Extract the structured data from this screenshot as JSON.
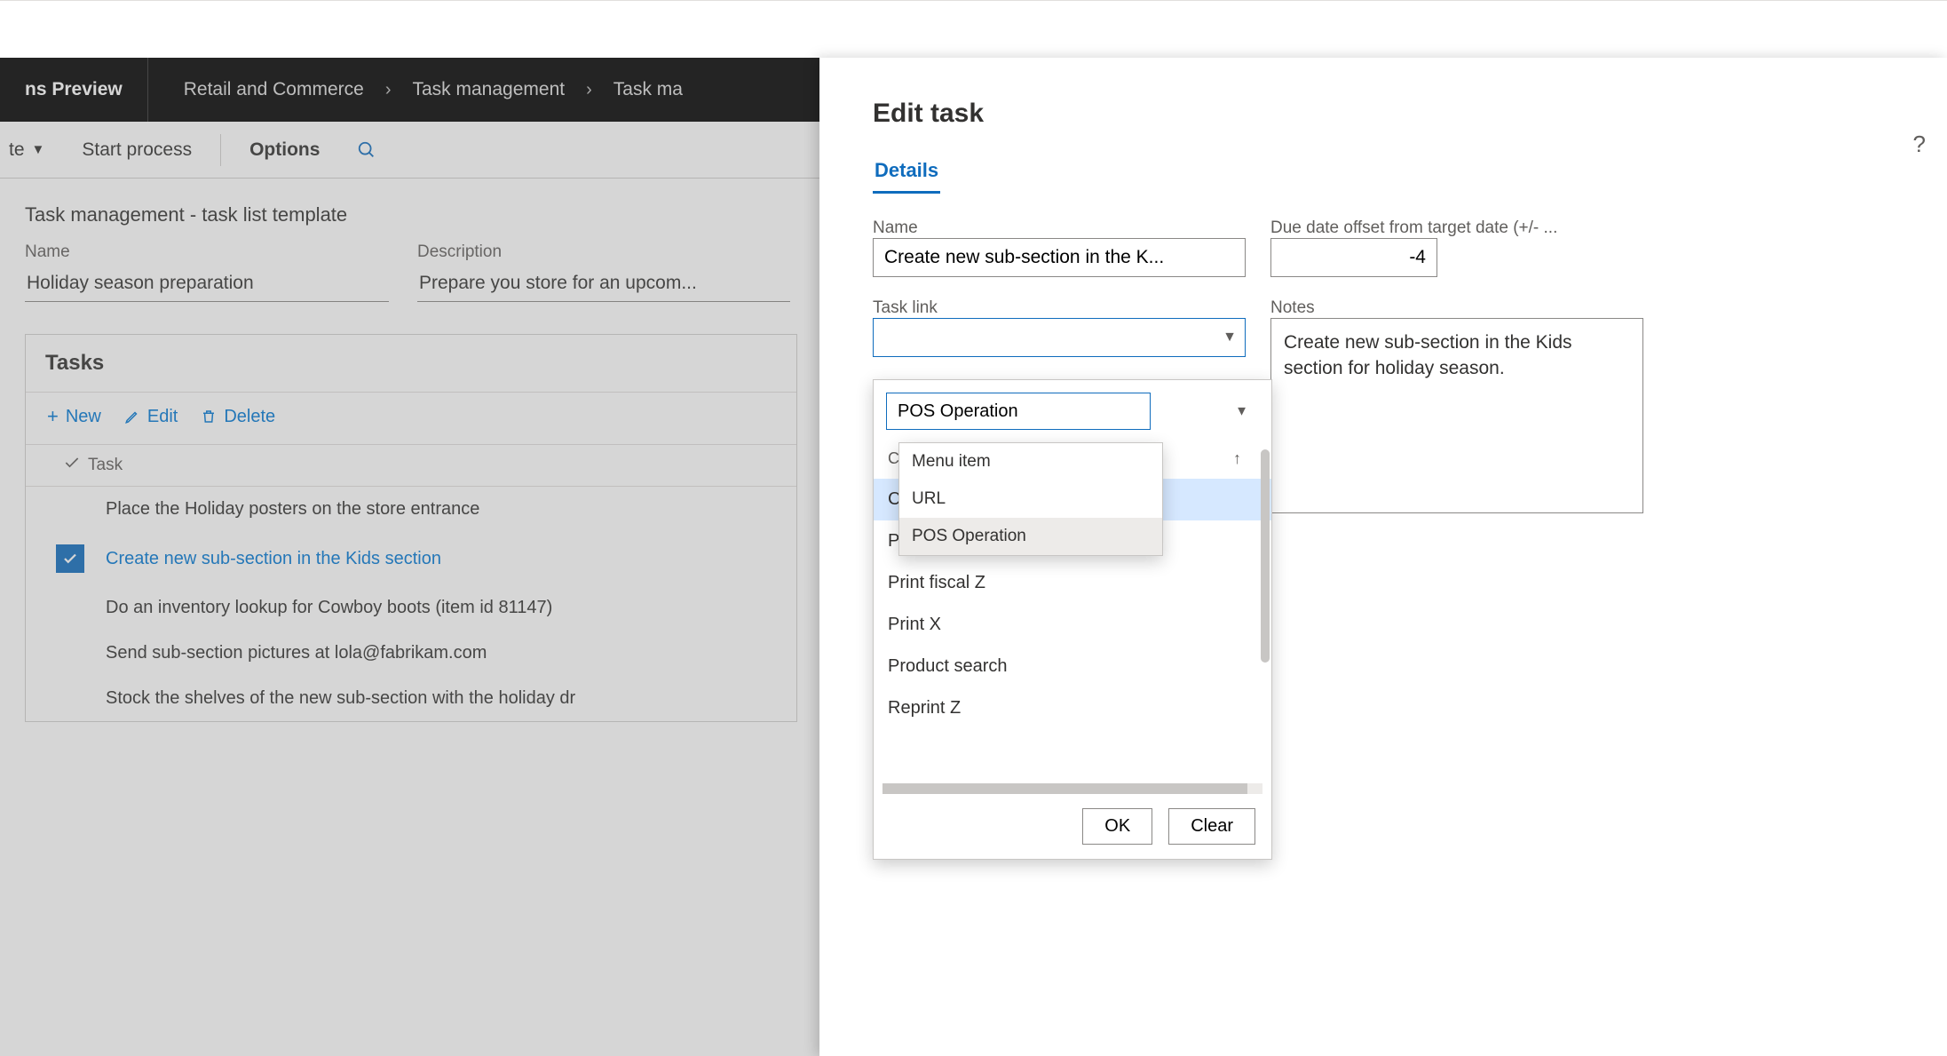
{
  "app_name_visible": "ns Preview",
  "breadcrumb": [
    "Retail and Commerce",
    "Task management",
    "Task ma"
  ],
  "action_bar": {
    "item0": "te",
    "start_process": "Start process",
    "options": "Options"
  },
  "page": {
    "title": "Task management - task list template",
    "name_label": "Name",
    "name_value": "Holiday season preparation",
    "desc_label": "Description",
    "desc_value": "Prepare you store for an upcom..."
  },
  "tasks": {
    "header": "Tasks",
    "toolbar": {
      "new": "New",
      "edit": "Edit",
      "delete": "Delete"
    },
    "column": "Task",
    "rows": [
      "Place the Holiday posters on the store entrance",
      "Create new sub-section in the Kids section",
      "Do an inventory lookup for Cowboy boots (item id 81147)",
      "Send sub-section pictures at lola@fabrikam.com",
      "Stock the shelves of the new sub-section with the holiday dr"
    ],
    "selected_index": 1
  },
  "panel": {
    "title": "Edit task",
    "tab": "Details",
    "name_label": "Name",
    "name_value": "Create new sub-section in the K...",
    "due_label": "Due date offset from target date (+/- ...",
    "due_value": "-4",
    "tasklink_label": "Task link",
    "tasklink_value": "",
    "notes_label": "Notes",
    "notes_value": "Create new sub-section in the Kids section for holiday season."
  },
  "lookup": {
    "type_value": "POS Operation",
    "type_options": [
      "Menu item",
      "URL",
      "POS Operation"
    ],
    "list_header_truncated": "C",
    "ops_visible": [
      {
        "text": "C...",
        "partial": true
      },
      {
        "text": "P",
        "partial": true
      },
      {
        "text": "Print fiscal Z",
        "partial": false
      },
      {
        "text": "Print X",
        "partial": false
      },
      {
        "text": "Product search",
        "partial": false
      },
      {
        "text": "Reprint Z",
        "partial": true
      }
    ],
    "ok": "OK",
    "clear": "Clear"
  }
}
